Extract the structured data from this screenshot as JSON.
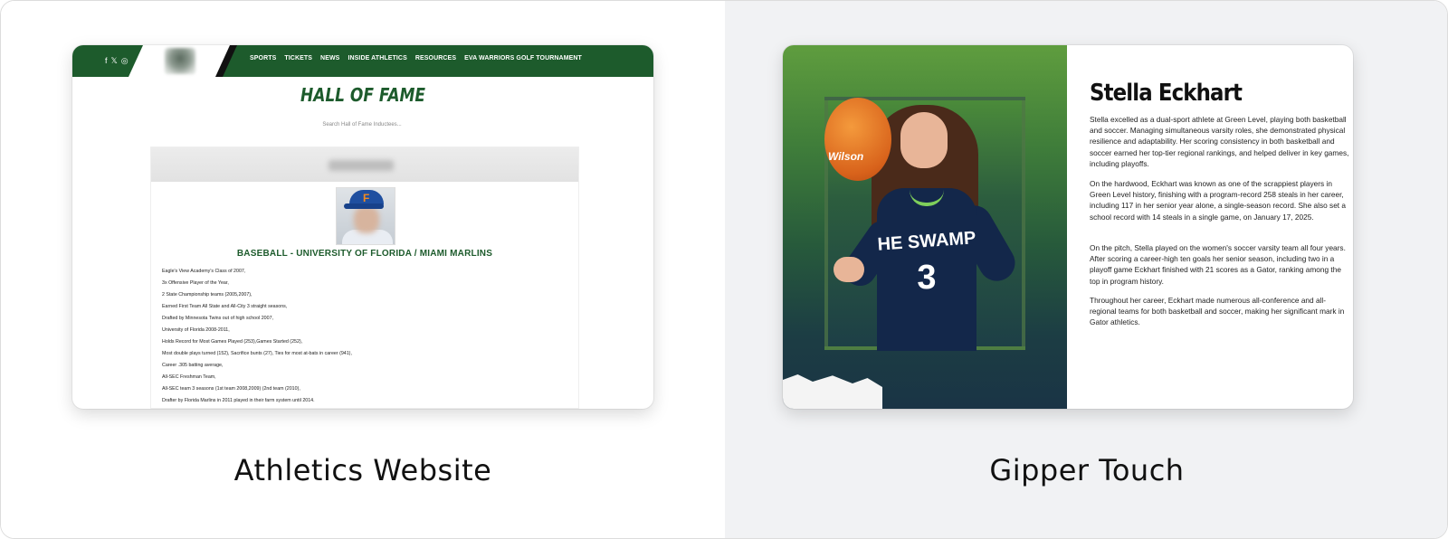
{
  "left": {
    "caption": "Athletics Website",
    "nav": {
      "social": [
        "f",
        "𝕏",
        "◎"
      ],
      "items": [
        "SPORTS",
        "TICKETS",
        "NEWS",
        "INSIDE ATHLETICS",
        "RESOURCES",
        "EVA WARRIORS GOLF TOURNAMENT"
      ]
    },
    "title": "HALL OF FAME",
    "search_placeholder": "Search Hall of Fame Inductees...",
    "profile": {
      "subtitle": "BASEBALL - UNIVERSITY OF FLORIDA / MIAMI MARLINS",
      "lines": [
        "Eagle's View Academy's Class of 2007,",
        "3x Offensive Player of the Year,",
        "2 State Championship teams (2005,2007),",
        "Earned First Team All State and All-City 3 straight seasons,",
        "Drafted by Minnesota Twins out of high school 2007,",
        "University of Florida 2008-2011,",
        "Holds Record for Most Games Played (253),Games Started (252),",
        "Most double plays turned (152), Sacrifice bunts (27), Ties for most at-bats in career (941),",
        "Career .305 batting average,",
        "All-SEC Freshman Team,",
        "All-SEC team 3 seasons (1st team 2008,2009) (2nd team (2010),",
        "Drafter by Florida Marlins in 2011 played in their farm system until 2014."
      ]
    }
  },
  "right": {
    "caption": "Gipper Touch",
    "name": "Stella Eckhart",
    "jersey_text": "HE SWAMP",
    "jersey_number": "3",
    "ball_text": "Wilson",
    "paragraphs": [
      "Stella excelled as a dual-sport athlete at Green Level, playing both basketball and soccer. Managing simultaneous varsity roles, she demonstrated physical resilience and adaptability. Her scoring consistency in both basketball and soccer earned her top-tier regional rankings, and helped deliver in key games, including playoffs.",
      "On the hardwood, Eckhart was known as one of the scrappiest players in Green Level history, finishing with a program-record 258 steals in her career, including 117 in her senior year alone, a single-season record. She also set a school record with 14 steals in a single game, on January 17, 2025.",
      "On the pitch, Stella played on the women's soccer varsity team all four years. After scoring a career-high ten goals her senior season, including two in a playoff game Eckhart finished with 21 scores as a Gator, ranking among the top in program history.",
      "Throughout her career, Eckhart made numerous all-conference and all-regional teams for both basketball and soccer, making her significant mark in Gator athletics."
    ]
  }
}
